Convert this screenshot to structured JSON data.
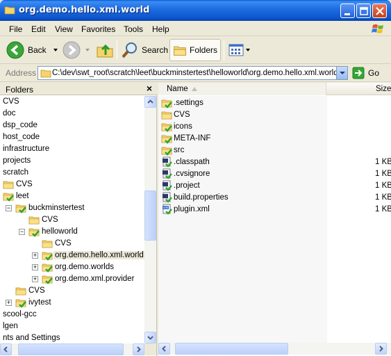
{
  "window": {
    "title": "org.demo.hello.xml.world"
  },
  "menu": {
    "items": [
      {
        "ul": "F",
        "rest": "ile"
      },
      {
        "ul": "E",
        "rest": "dit"
      },
      {
        "ul": "V",
        "rest": "iew"
      },
      {
        "ul": "",
        "pre": "F",
        "ul2": "a",
        "rest": "vorites"
      },
      {
        "ul": "T",
        "rest": "ools"
      },
      {
        "ul": "H",
        "rest": "elp"
      }
    ],
    "labels": [
      "File",
      "Edit",
      "View",
      "Favorites",
      "Tools",
      "Help"
    ]
  },
  "toolbar": {
    "back_label": "Back",
    "search_label": "Search",
    "folders_label": "Folders"
  },
  "address": {
    "label": "Address",
    "value": "C:\\dev\\swt_root\\scratch\\leet\\buckminstertest\\helloworld\\org.demo.hello.xml.world",
    "go_label": "Go"
  },
  "folders_pane": {
    "title": "Folders",
    "close": "×",
    "tree": [
      {
        "label": "CVS",
        "indent": 0,
        "icon": "none"
      },
      {
        "label": "doc",
        "indent": 0,
        "icon": "none"
      },
      {
        "label": "dsp_code",
        "indent": 0,
        "icon": "none"
      },
      {
        "label": "host_code",
        "indent": 0,
        "icon": "none"
      },
      {
        "label": "infrastructure",
        "indent": 0,
        "icon": "none"
      },
      {
        "label": "projects",
        "indent": 0,
        "icon": "none"
      },
      {
        "label": "scratch",
        "indent": 0,
        "icon": "none"
      },
      {
        "label": "CVS",
        "indent": 1,
        "icon": "folder"
      },
      {
        "label": "leet",
        "indent": 1,
        "icon": "folder-check"
      },
      {
        "label": "buckminstertest",
        "indent": 2,
        "icon": "folder-check",
        "expander": "−"
      },
      {
        "label": "CVS",
        "indent": 3,
        "icon": "folder"
      },
      {
        "label": "helloworld",
        "indent": 3,
        "icon": "folder-check",
        "expander": "−"
      },
      {
        "label": "CVS",
        "indent": 4,
        "icon": "folder"
      },
      {
        "label": "org.demo.hello.xml.world",
        "indent": 4,
        "icon": "folder-check",
        "expander": "+",
        "selected": true
      },
      {
        "label": "org.demo.worlds",
        "indent": 4,
        "icon": "folder-check",
        "expander": "+"
      },
      {
        "label": "org.demo.xml.provider",
        "indent": 4,
        "icon": "folder-check",
        "expander": "+"
      },
      {
        "label": "CVS",
        "indent": 2,
        "icon": "folder"
      },
      {
        "label": "ivytest",
        "indent": 2,
        "icon": "folder-check",
        "expander": "+"
      },
      {
        "label": "scool-gcc",
        "indent": 0,
        "icon": "none"
      },
      {
        "label": "lgen",
        "indent": 0,
        "icon": "none"
      },
      {
        "label": "nts and Settings",
        "indent": 0,
        "icon": "none"
      }
    ]
  },
  "content_pane": {
    "columns": {
      "name": "Name",
      "size": "Size"
    },
    "files": [
      {
        "name": ".settings",
        "icon": "folder-check",
        "size": ""
      },
      {
        "name": "CVS",
        "icon": "folder",
        "size": ""
      },
      {
        "name": "icons",
        "icon": "folder-check",
        "size": ""
      },
      {
        "name": "META-INF",
        "icon": "folder-check",
        "size": ""
      },
      {
        "name": "src",
        "icon": "folder-check",
        "size": ""
      },
      {
        "name": ".classpath",
        "icon": "file-check",
        "size": "1 KB"
      },
      {
        "name": ".cvsignore",
        "icon": "file-check",
        "size": "1 KB"
      },
      {
        "name": ".project",
        "icon": "file-check",
        "size": "1 KB"
      },
      {
        "name": "build.properties",
        "icon": "file-check",
        "size": "1 KB"
      },
      {
        "name": "plugin.xml",
        "icon": "xml-check",
        "size": "1 KB"
      }
    ]
  },
  "colors": {
    "folder": "#f6d46a",
    "check": "#2fa52f",
    "titlebar": "#0b54cc"
  }
}
